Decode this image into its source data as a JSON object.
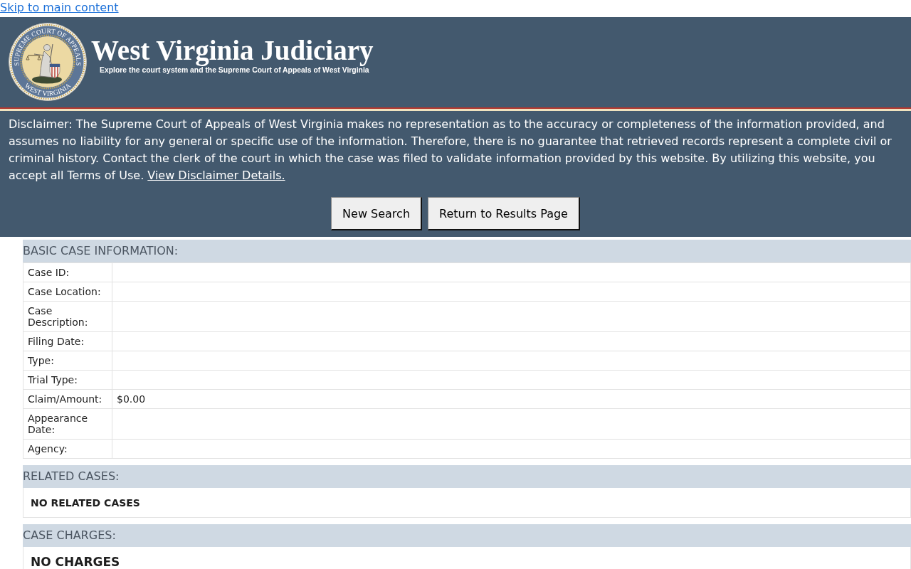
{
  "skip_link": "Skip to main content",
  "header": {
    "seal": {
      "top_text": "SUPREME COURT OF APPEALS",
      "bottom_text": "WEST VIRGINIA"
    },
    "title": "West Virginia Judiciary",
    "subtitle": "Explore the court system and the Supreme Court of Appeals of West Virginia"
  },
  "disclaimer": {
    "text": "Disclaimer: The Supreme Court of Appeals of West Virginia makes no representation as to the accuracy or completeness of the information provided, and assumes no liability for any general or specific use of the information. Therefore, there is no guarantee that retrieved records represent a complete civil or criminal history. Contact the clerk of the court in which the case was filed to validate information provided by this website. By utilizing this website, you accept all Terms of Use.",
    "link": "View Disclaimer Details."
  },
  "buttons": [
    {
      "label": "New Search"
    },
    {
      "label": "Return to Results Page"
    }
  ],
  "sections": [
    {
      "kind": "table",
      "title": "BASIC CASE INFORMATION:",
      "rows": [
        {
          "label": "Case ID:"
        },
        {
          "label": "Case Location:"
        },
        {
          "label": "Case Description:"
        },
        {
          "label": "Filing Date:"
        },
        {
          "label": "Type:"
        },
        {
          "label": "Trial Type:"
        },
        {
          "label": "Claim/Amount:",
          "value": "$0.00"
        },
        {
          "label": "Appearance Date:"
        },
        {
          "label": "Agency:"
        }
      ]
    },
    {
      "kind": "note",
      "title": "RELATED CASES:",
      "message": "NO RELATED CASES"
    },
    {
      "kind": "banner",
      "title": "CASE CHARGES:",
      "message": "NO CHARGES"
    }
  ]
}
